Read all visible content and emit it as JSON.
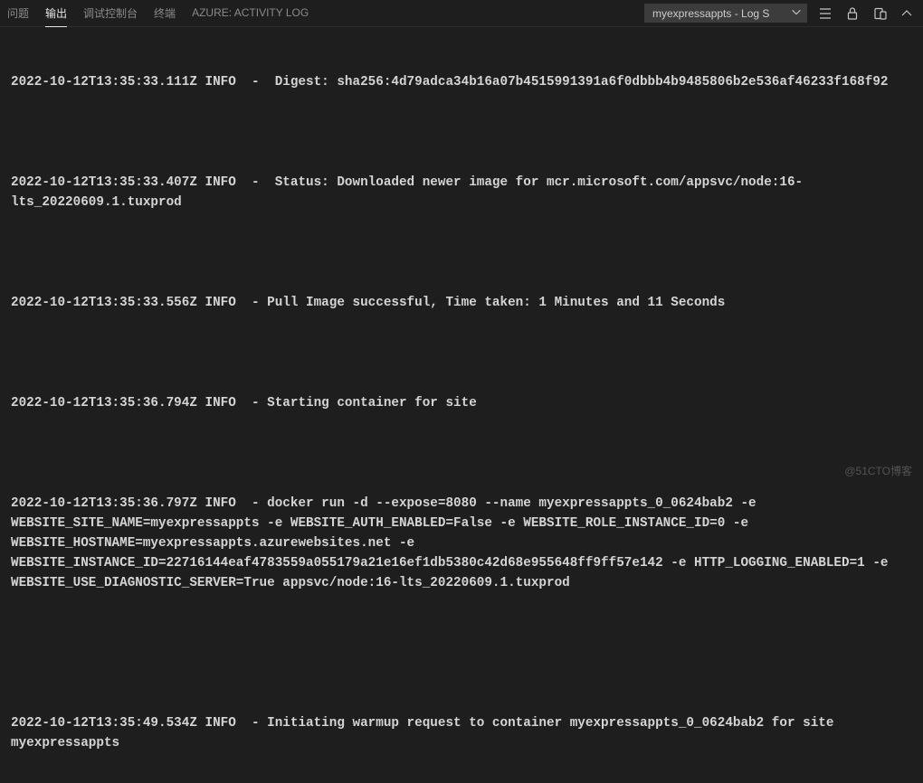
{
  "header": {
    "tabs": [
      {
        "label": "问题",
        "active": false
      },
      {
        "label": "输出",
        "active": true
      },
      {
        "label": "调试控制台",
        "active": false
      },
      {
        "label": "终端",
        "active": false
      },
      {
        "label": "AZURE: ACTIVITY LOG",
        "active": false
      }
    ],
    "dropdown": "myexpressappts - Log S",
    "icons": {
      "list": "list-icon",
      "lock": "lock-icon",
      "clear": "clear-icon",
      "chevronUp": "chevron-up-icon"
    }
  },
  "logs": [
    "2022-10-12T13:35:33.111Z INFO  -  Digest: sha256:4d79adca34b16a07b4515991391a6f0dbbb4b9485806b2e536af46233f168f92",
    "",
    "2022-10-12T13:35:33.407Z INFO  -  Status: Downloaded newer image for mcr.microsoft.com/appsvc/node:16-lts_20220609.1.tuxprod",
    "",
    "2022-10-12T13:35:33.556Z INFO  - Pull Image successful, Time taken: 1 Minutes and 11 Seconds",
    "",
    "2022-10-12T13:35:36.794Z INFO  - Starting container for site",
    "",
    "2022-10-12T13:35:36.797Z INFO  - docker run -d --expose=8080 --name myexpressappts_0_0624bab2 -e WEBSITE_SITE_NAME=myexpressappts -e WEBSITE_AUTH_ENABLED=False -e WEBSITE_ROLE_INSTANCE_ID=0 -e WEBSITE_HOSTNAME=myexpressappts.azurewebsites.net -e WEBSITE_INSTANCE_ID=22716144eaf4783559a055179a21e16ef1db5380c42d68e955648ff9ff57e142 -e HTTP_LOGGING_ENABLED=1 -e WEBSITE_USE_DIAGNOSTIC_SERVER=True appsvc/node:16-lts_20220609.1.tuxprod",
    "",
    "",
    "2022-10-12T13:35:49.534Z INFO  - Initiating warmup request to container myexpressappts_0_0624bab2 for site myexpressappts"
  ],
  "watermark": "@51CTO博客"
}
